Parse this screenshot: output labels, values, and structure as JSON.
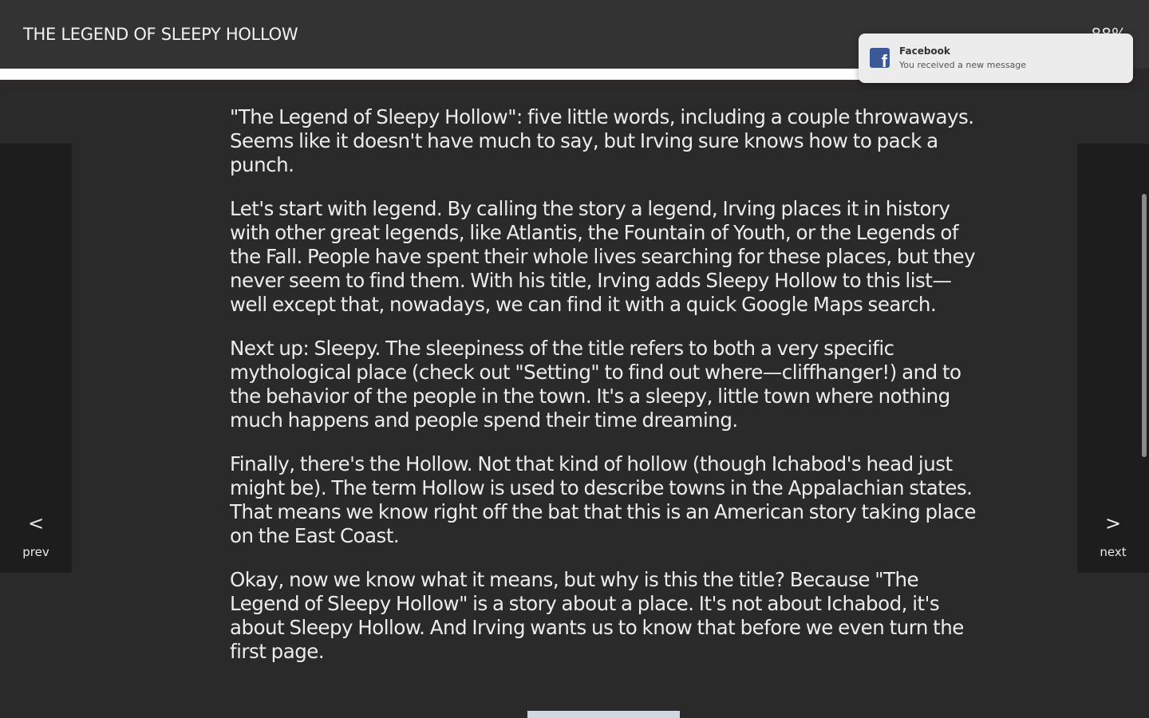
{
  "header": {
    "title": "THE LEGEND OF SLEEPY HOLLOW",
    "progress_percent_text": "88%",
    "progress_fraction": 0.75
  },
  "navigation": {
    "prev_arrow": "<",
    "prev_label": "prev",
    "next_arrow": ">",
    "next_label": "next"
  },
  "content": {
    "paragraphs": [
      "\"The Legend of Sleepy Hollow\": five little words, including a couple throwaways. Seems like it doesn't have much to say, but Irving sure knows how to pack a punch.",
      "Let's start with legend. By calling the story a legend, Irving places it in history with other great legends, like Atlantis, the Fountain of Youth, or the Legends of the Fall. People have spent their whole lives searching for these places, but they never seem to find them. With his title, Irving adds Sleepy Hollow to this list—well except that, nowadays, we can find it with a quick Google Maps search.",
      "Next up: Sleepy. The sleepiness of the title refers to both a very specific mythological place (check out \"Setting\" to find out where—cliffhanger!) and to the behavior of the people in the town. It's a sleepy, little town where nothing much happens and people spend their time dreaming.",
      "Finally, there's the Hollow. Not that kind of hollow (though Ichabod's head just might be). The term Hollow is used to describe towns in the Appalachian states. That means we know right off the bat that this is an American story taking place on the East Coast.",
      "Okay, now we know what it means, but why is this the title? Because \"The Legend of Sleepy Hollow\" is a story about a place. It's not about Ichabod, it's about Sleepy Hollow. And Irving wants us to know that before we even turn the first page."
    ]
  },
  "notification": {
    "app": "Facebook",
    "message": "You received a new message",
    "icon": "facebook-icon"
  },
  "colors": {
    "background": "#2a2a2a",
    "header": "#333333",
    "side_nav": "#1d1d1d",
    "text": "#ececec",
    "facebook_blue": "#3b5998"
  }
}
